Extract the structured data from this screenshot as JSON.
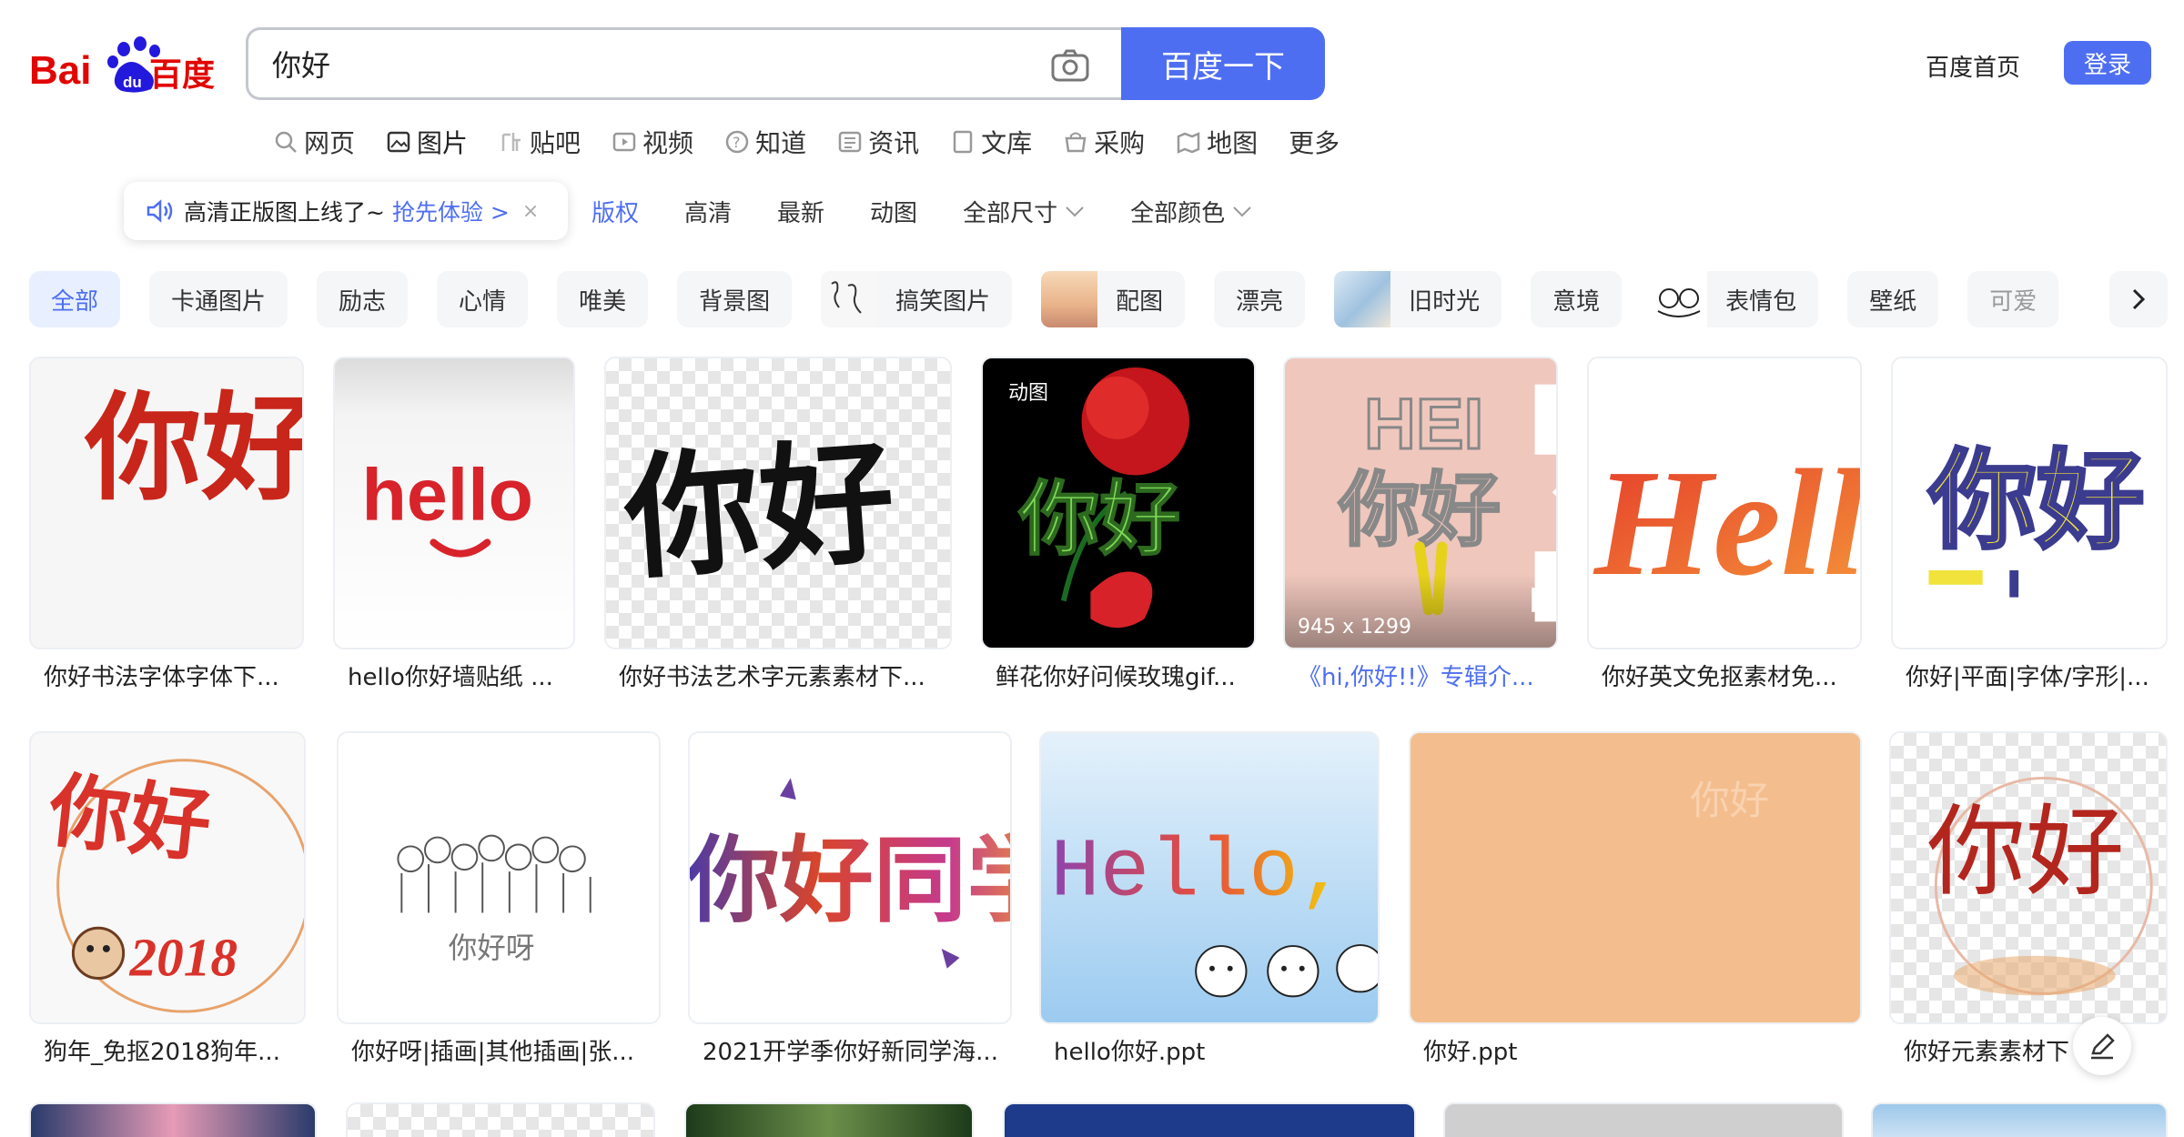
{
  "header": {
    "logo_text": "Bai百度",
    "search_value": "你好",
    "search_button": "百度一下",
    "home_link": "百度首页",
    "login": "登录"
  },
  "nav": {
    "items": [
      {
        "label": "网页",
        "icon": "search-icon"
      },
      {
        "label": "图片",
        "icon": "image-icon"
      },
      {
        "label": "贴吧",
        "icon": "tieba-icon"
      },
      {
        "label": "视频",
        "icon": "video-icon"
      },
      {
        "label": "知道",
        "icon": "question-icon"
      },
      {
        "label": "资讯",
        "icon": "news-icon"
      },
      {
        "label": "文库",
        "icon": "doc-icon"
      },
      {
        "label": "采购",
        "icon": "cart-icon"
      },
      {
        "label": "地图",
        "icon": "map-icon"
      },
      {
        "label": "更多",
        "icon": ""
      }
    ],
    "active_index": 1
  },
  "promo": {
    "text": "高清正版图上线了~",
    "link": "抢先体验 >",
    "close": "×"
  },
  "filters": [
    {
      "label": "版权",
      "dropdown": false
    },
    {
      "label": "高清",
      "dropdown": false
    },
    {
      "label": "最新",
      "dropdown": false
    },
    {
      "label": "动图",
      "dropdown": false
    },
    {
      "label": "全部尺寸",
      "dropdown": true
    },
    {
      "label": "全部颜色",
      "dropdown": true
    }
  ],
  "tags": [
    {
      "label": "全部",
      "active": true
    },
    {
      "label": "卡通图片"
    },
    {
      "label": "励志"
    },
    {
      "label": "心情"
    },
    {
      "label": "唯美"
    },
    {
      "label": "背景图"
    },
    {
      "label": "搞笑图片",
      "thumb": true
    },
    {
      "label": "配图",
      "thumb": true
    },
    {
      "label": "漂亮"
    },
    {
      "label": "旧时光",
      "thumb": true
    },
    {
      "label": "意境"
    },
    {
      "label": "表情包",
      "thumb": true
    },
    {
      "label": "壁纸"
    },
    {
      "label": "可爱"
    }
  ],
  "results": {
    "row1": [
      {
        "caption": "你好书法字体字体下..."
      },
      {
        "caption": "hello你好墙贴纸 ..."
      },
      {
        "caption": "你好书法艺术字元素素材下..."
      },
      {
        "caption": "鲜花你好问候玫瑰gif...",
        "badge": "动图"
      },
      {
        "caption": "《hi,你好!!》专辑介...",
        "dims": "945 x 1299"
      },
      {
        "caption": "你好英文免抠素材免..."
      },
      {
        "caption": "你好|平面|字体/字形|..."
      }
    ],
    "row2": [
      {
        "caption": "狗年_免抠2018狗年..."
      },
      {
        "caption": "你好呀|插画|其他插画|张..."
      },
      {
        "caption": "2021开学季你好新同学海..."
      },
      {
        "caption": "hello你好.ppt"
      },
      {
        "caption": "你好.ppt"
      },
      {
        "caption": "你好元素素材下"
      }
    ]
  },
  "image_text": {
    "nihao": "你好",
    "nihao_fancy": "你好",
    "hello": "hello",
    "hello_cap": "Hello",
    "hei": "HEI",
    "year": "2018",
    "tongxue": "你好同学",
    "hello_comma": "Hello, 你好",
    "nihao_ya": "你好呀",
    "nihao_faint": "你好"
  },
  "colors": {
    "accent": "#4e6ef2",
    "tag_active_bg": "#e8f0ff",
    "peach": "#f4bd8d"
  }
}
